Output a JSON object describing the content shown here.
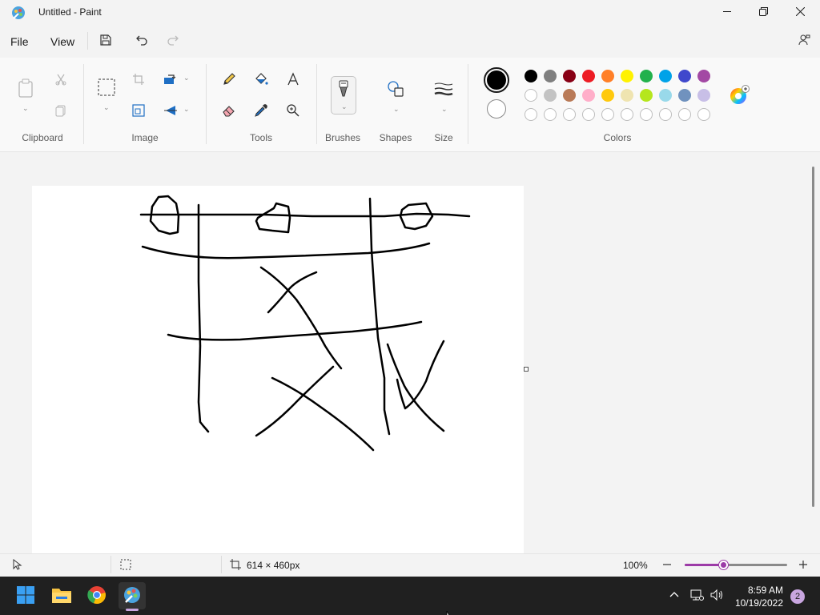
{
  "window": {
    "title": "Untitled - Paint",
    "minimize_icon": "minimize-icon",
    "maximize_icon": "restore-icon",
    "close_icon": "close-icon"
  },
  "menu": {
    "file_label": "File",
    "view_label": "View",
    "save_icon": "save-icon",
    "undo_icon": "undo-icon",
    "redo_icon": "redo-icon",
    "share_icon": "share-icon"
  },
  "ribbon": {
    "groups": {
      "clipboard": "Clipboard",
      "image": "Image",
      "tools": "Tools",
      "brushes": "Brushes",
      "shapes": "Shapes",
      "size": "Size",
      "colors": "Colors"
    },
    "colors": {
      "primary": "#000000",
      "secondary": "#ffffff",
      "palette_row1": [
        "#000000",
        "#7f7f7f",
        "#880015",
        "#ed1c24",
        "#ff7f27",
        "#fff200",
        "#22b14c",
        "#00a2e8",
        "#3f48cc",
        "#a349a4"
      ],
      "palette_row2": [
        "#ffffff",
        "#c3c3c3",
        "#b97a57",
        "#ffaec9",
        "#ffc90e",
        "#efe4b0",
        "#b5e61d",
        "#99d9ea",
        "#7092be",
        "#c8bfe7"
      ],
      "palette_row3_empty": 10
    }
  },
  "status": {
    "canvas_size": "614 × 460px",
    "zoom": "100%",
    "zoom_level_fraction": 0.38
  },
  "taskbar": {
    "time": "8:59 AM",
    "date": "10/19/2022",
    "notifications": "2",
    "apps": [
      "start-icon",
      "file-explorer-icon",
      "chrome-icon",
      "paint-icon"
    ]
  },
  "accent": "#9c3ba7"
}
